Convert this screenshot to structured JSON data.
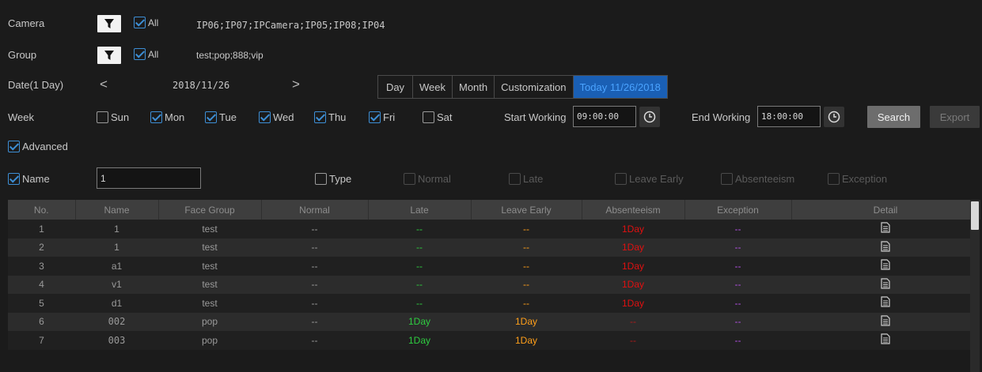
{
  "camera": {
    "label": "Camera",
    "all_label": "All",
    "selected": "IP06;IP07;IPCamera;IP05;IP08;IP04"
  },
  "group": {
    "label": "Group",
    "all_label": "All",
    "selected": "test;pop;888;vip"
  },
  "date": {
    "label": "Date(1 Day)",
    "prev": "<",
    "value": "2018/11/26",
    "next": ">"
  },
  "range_tabs": [
    "Day",
    "Week",
    "Month",
    "Customization",
    "Today 11/26/2018"
  ],
  "week": {
    "label": "Week",
    "days": [
      {
        "label": "Sun",
        "checked": false
      },
      {
        "label": "Mon",
        "checked": true
      },
      {
        "label": "Tue",
        "checked": true
      },
      {
        "label": "Wed",
        "checked": true
      },
      {
        "label": "Thu",
        "checked": true
      },
      {
        "label": "Fri",
        "checked": true
      },
      {
        "label": "Sat",
        "checked": false
      }
    ],
    "start_label": "Start Working",
    "start_value": "09:00:00",
    "end_label": "End Working",
    "end_value": "18:00:00"
  },
  "buttons": {
    "search": "Search",
    "export": "Export"
  },
  "advanced": {
    "label": "Advanced"
  },
  "name_filter": {
    "label": "Name",
    "value": "1"
  },
  "type_filter": {
    "label": "Type",
    "options": [
      "Normal",
      "Late",
      "Leave Early",
      "Absenteeism",
      "Exception"
    ]
  },
  "table": {
    "headers": [
      "No.",
      "Name",
      "Face Group",
      "Normal",
      "Late",
      "Leave Early",
      "Absenteeism",
      "Exception",
      "Detail"
    ],
    "rows": [
      {
        "no": "1",
        "name": "1",
        "group": "test",
        "normal": "--",
        "late": "--",
        "leave": "--",
        "absent": "1Day",
        "exception": "--"
      },
      {
        "no": "2",
        "name": "1",
        "group": "test",
        "normal": "--",
        "late": "--",
        "leave": "--",
        "absent": "1Day",
        "exception": "--"
      },
      {
        "no": "3",
        "name": "a1",
        "group": "test",
        "normal": "--",
        "late": "--",
        "leave": "--",
        "absent": "1Day",
        "exception": "--"
      },
      {
        "no": "4",
        "name": "v1",
        "group": "test",
        "normal": "--",
        "late": "--",
        "leave": "--",
        "absent": "1Day",
        "exception": "--"
      },
      {
        "no": "5",
        "name": "d1",
        "group": "test",
        "normal": "--",
        "late": "--",
        "leave": "--",
        "absent": "1Day",
        "exception": "--"
      },
      {
        "no": "6",
        "name": "002",
        "group": "pop",
        "normal": "--",
        "late": "1Day",
        "leave": "1Day",
        "absent": "--",
        "exception": "--"
      },
      {
        "no": "7",
        "name": "003",
        "group": "pop",
        "normal": "--",
        "late": "1Day",
        "leave": "1Day",
        "absent": "--",
        "exception": "--"
      }
    ]
  },
  "colors": {
    "background": "#1b1b1b",
    "accent": "#3d8fd6",
    "late": "#2ecc40",
    "leave_early": "#ff9f1a",
    "absenteeism": "#e01010",
    "exception": "#b050e0"
  },
  "icons": {
    "filter": "funnel-icon",
    "clock": "clock-icon",
    "detail": "document-icon"
  }
}
